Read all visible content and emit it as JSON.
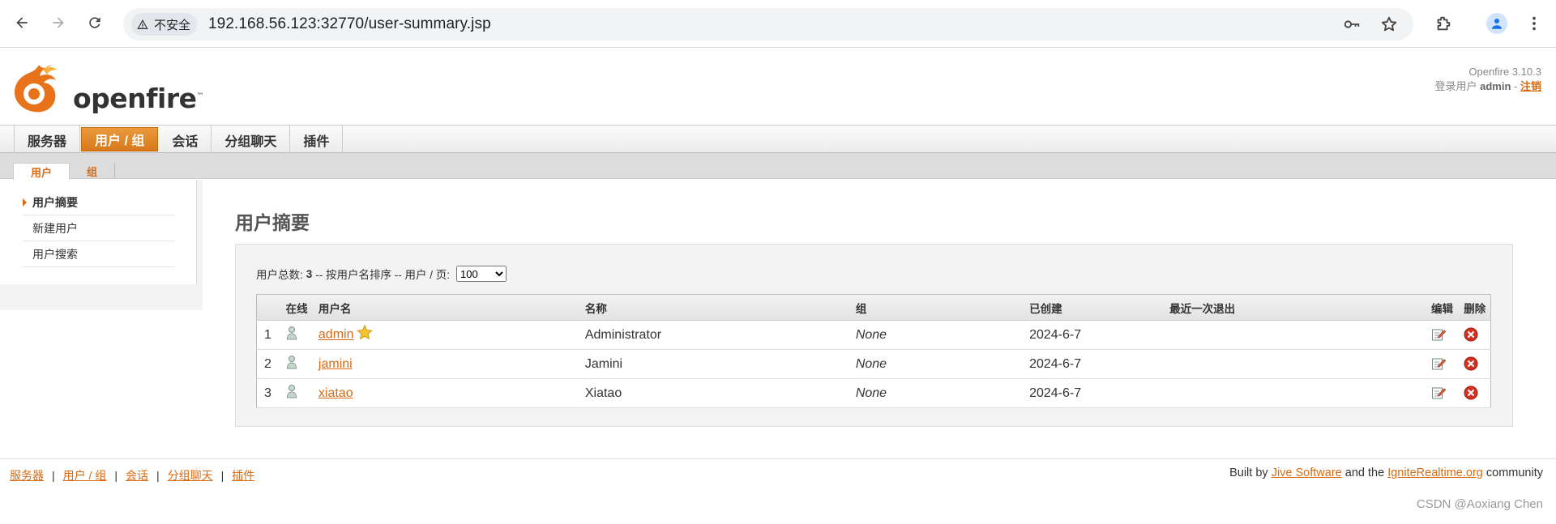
{
  "browser": {
    "security_label": "不安全",
    "url": "192.168.56.123:32770/user-summary.jsp"
  },
  "header": {
    "version": "Openfire 3.10.3",
    "login_prefix": "登录用户",
    "username": "admin",
    "logout": "注销",
    "logo_text": "openfire"
  },
  "tabs": [
    {
      "label": "服务器",
      "active": false
    },
    {
      "label": "用户 / 组",
      "active": true
    },
    {
      "label": "会话",
      "active": false
    },
    {
      "label": "分组聊天",
      "active": false
    },
    {
      "label": "插件",
      "active": false
    }
  ],
  "subtabs": [
    {
      "label": "用户",
      "active": true
    },
    {
      "label": "组",
      "active": false
    }
  ],
  "sidebar": {
    "items": [
      {
        "label": "用户摘要",
        "active": true
      },
      {
        "label": "新建用户",
        "active": false
      },
      {
        "label": "用户搜索",
        "active": false
      }
    ]
  },
  "main": {
    "title": "用户摘要",
    "summary_prefix": "用户总数:",
    "total": "3",
    "summary_suffix": "-- 按用户名排序 -- 用户 / 页:",
    "per_page": "100",
    "columns": [
      "在线",
      "用户名",
      "名称",
      "组",
      "已创建",
      "最近一次退出",
      "编辑",
      "删除"
    ],
    "rows": [
      {
        "index": "1",
        "username": "admin",
        "name": "Administrator",
        "group": "None",
        "created": "2024-6-7",
        "last_logout": "",
        "is_admin": true
      },
      {
        "index": "2",
        "username": "jamini",
        "name": "Jamini",
        "group": "None",
        "created": "2024-6-7",
        "last_logout": "",
        "is_admin": false
      },
      {
        "index": "3",
        "username": "xiatao",
        "name": "Xiatao",
        "group": "None",
        "created": "2024-6-7",
        "last_logout": "",
        "is_admin": false
      }
    ]
  },
  "footer": {
    "links": [
      "服务器",
      "用户 / 组",
      "会话",
      "分组聊天",
      "插件"
    ],
    "built_by": "Built by",
    "jive": "Jive Software",
    "and_the": "and the",
    "ignite": "IgniteRealtime.org",
    "community": "community"
  },
  "watermark": "CSDN @Aoxiang Chen",
  "colors": {
    "accent": "#d86b14",
    "active_tab": "#e08a2a"
  }
}
